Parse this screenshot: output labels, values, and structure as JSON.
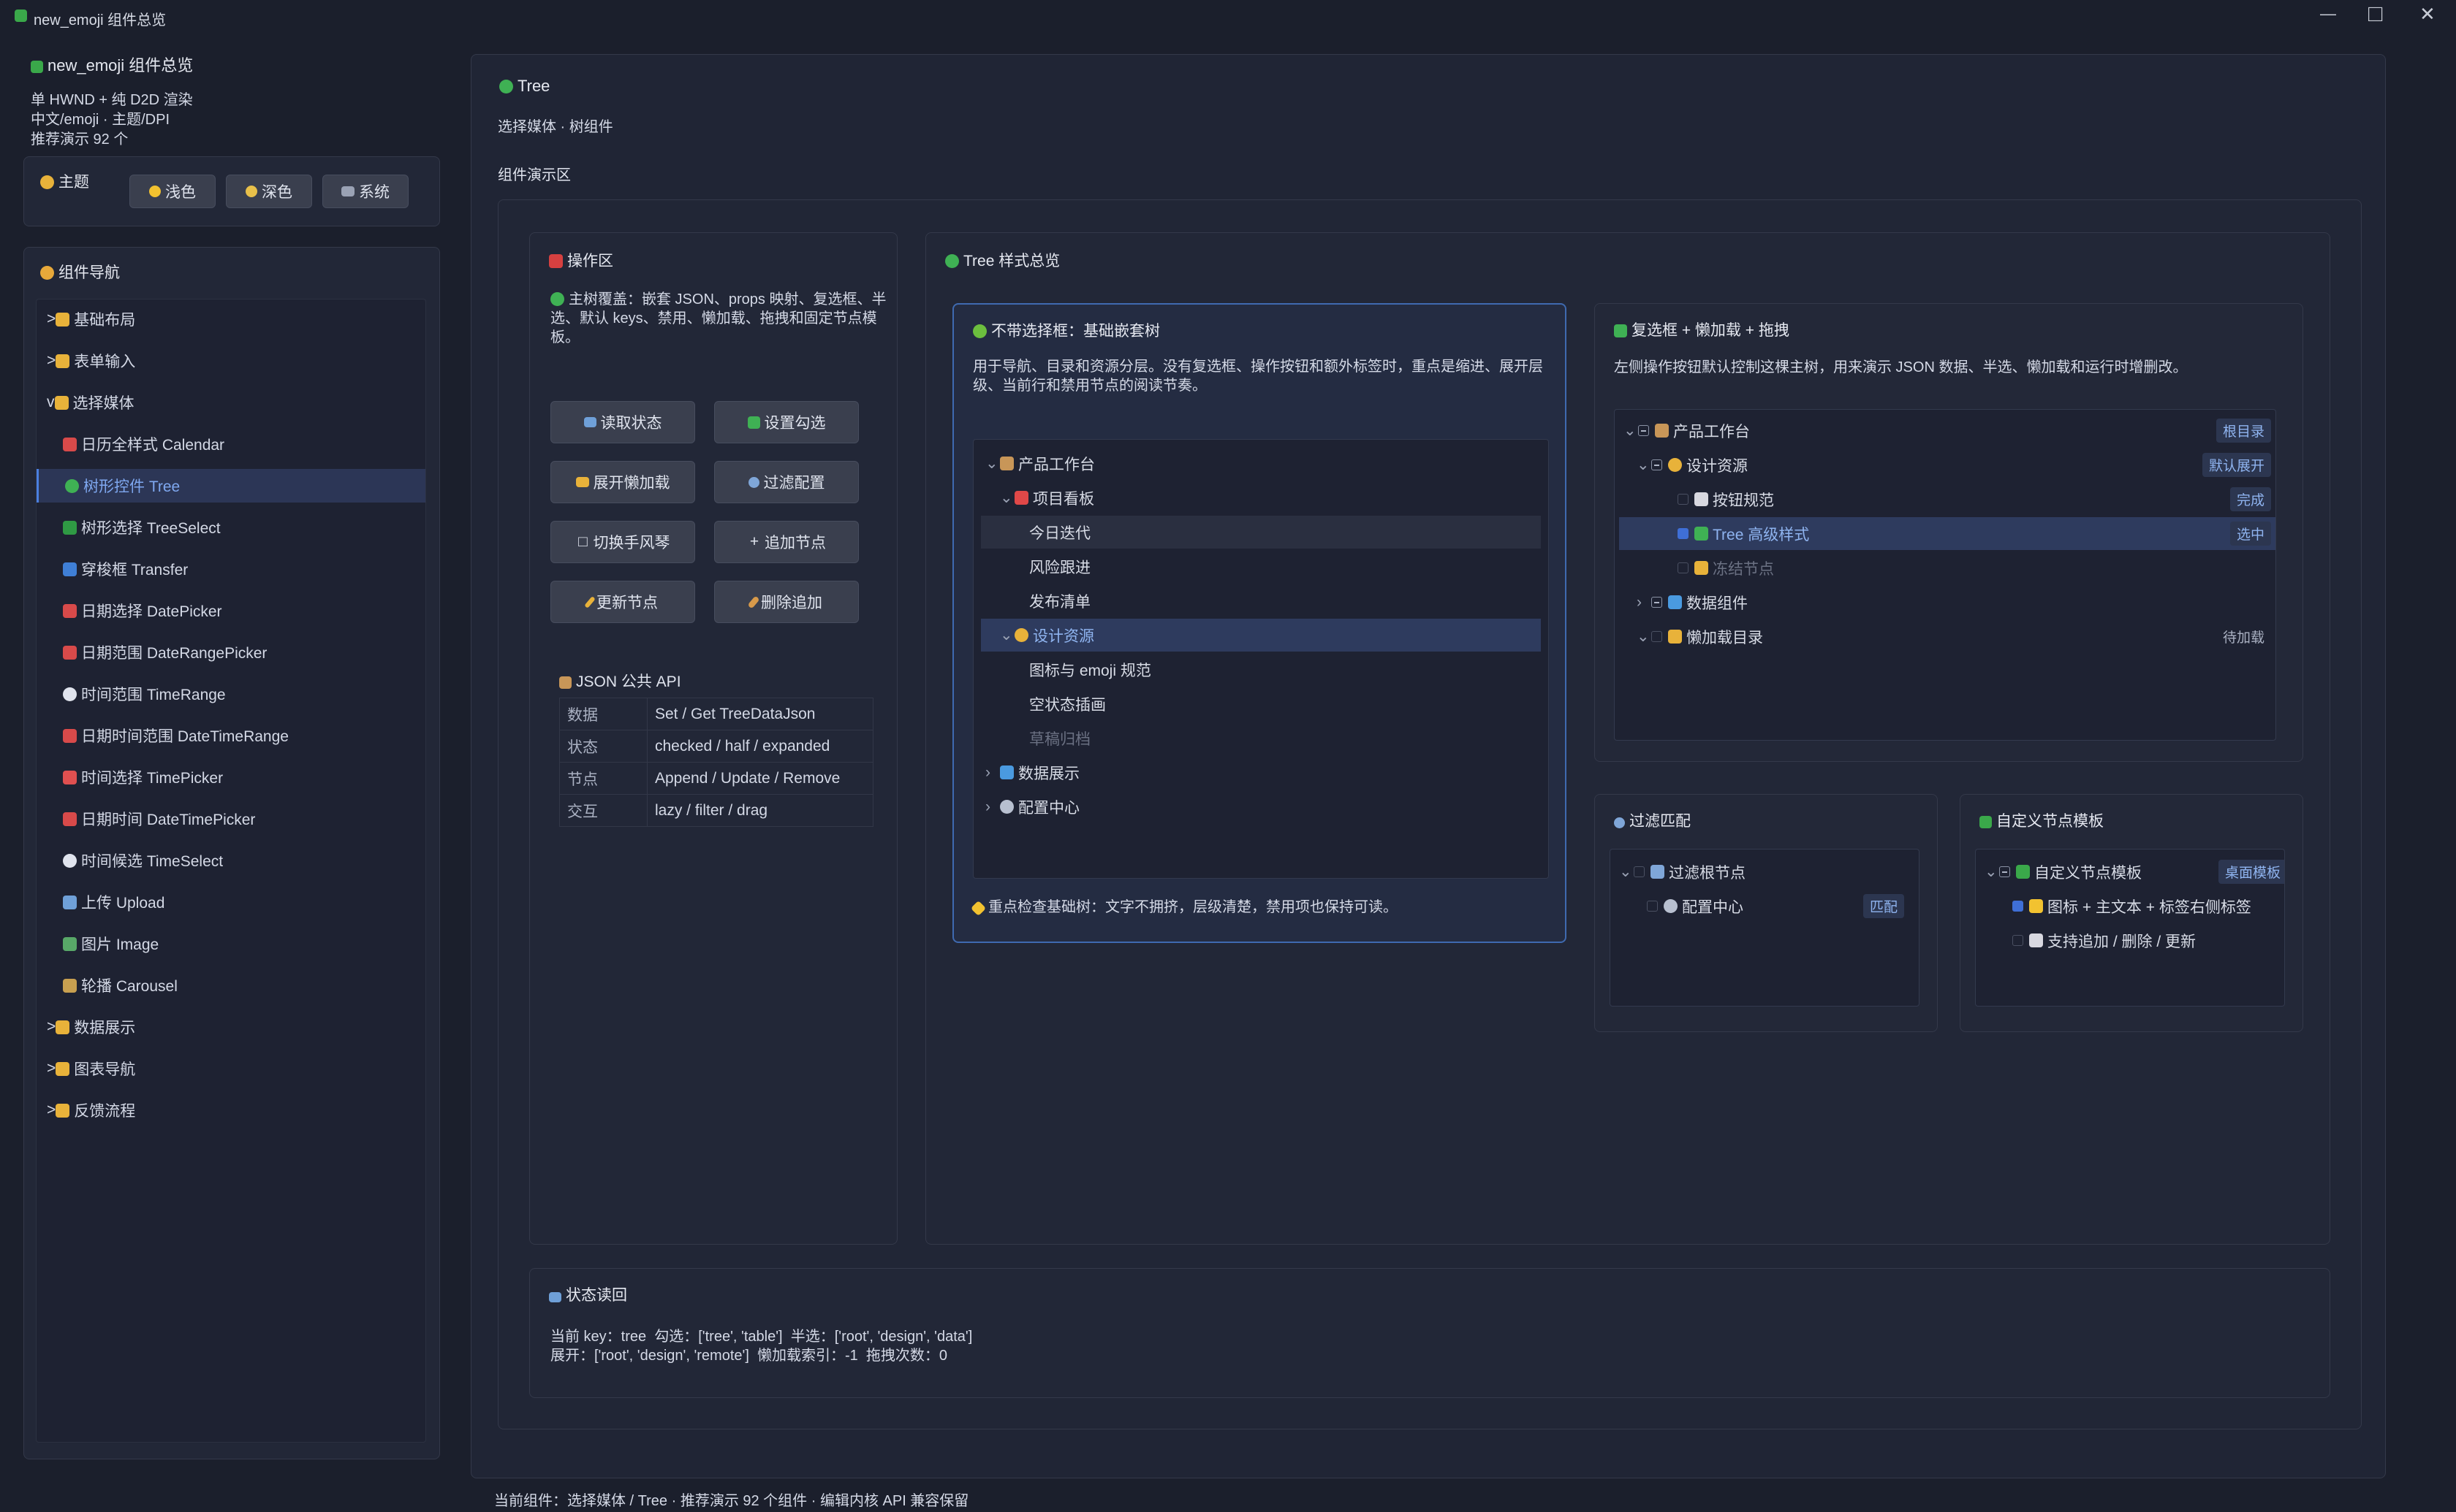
{
  "window": {
    "title": "new_emoji 组件总览",
    "controls": {
      "minimize": "—",
      "maximize": "□",
      "close": "✕"
    }
  },
  "sidebar": {
    "app_title": "new_emoji 组件总览",
    "subtitle_lines": [
      "单 HWND + 纯 D2D 渲染",
      "中文/emoji · 主题/DPI",
      "推荐演示 92 个"
    ],
    "theme": {
      "title": "主题",
      "buttons": [
        "浅色",
        "深色",
        "系统"
      ]
    },
    "nav": {
      "title": "组件导航",
      "items": [
        {
          "label": "基础布局",
          "prefix": ">",
          "icon": "folder-icon"
        },
        {
          "label": "表单输入",
          "prefix": ">",
          "icon": "folder-icon"
        },
        {
          "label": "选择媒体",
          "prefix": "v",
          "icon": "folder-icon"
        },
        {
          "label": "日历全样式 Calendar",
          "icon": "calendar-icon"
        },
        {
          "label": "树形控件 Tree",
          "icon": "tree-icon",
          "selected": true
        },
        {
          "label": "树形选择 TreeSelect",
          "icon": "pine-tree-icon"
        },
        {
          "label": "穿梭框 Transfer",
          "icon": "transfer-icon"
        },
        {
          "label": "日期选择 DatePicker",
          "icon": "calendar-icon"
        },
        {
          "label": "日期范围 DateRangePicker",
          "icon": "calendar-icon"
        },
        {
          "label": "时间范围 TimeRange",
          "icon": "clock-icon"
        },
        {
          "label": "日期时间范围 DateTimeRange",
          "icon": "calendar-icon"
        },
        {
          "label": "时间选择 TimePicker",
          "icon": "alarm-clock-icon"
        },
        {
          "label": "日期时间 DateTimePicker",
          "icon": "calendar-icon"
        },
        {
          "label": "时间候选 TimeSelect",
          "icon": "clock-icon"
        },
        {
          "label": "上传 Upload",
          "icon": "inbox-icon"
        },
        {
          "label": "图片 Image",
          "icon": "picture-icon"
        },
        {
          "label": "轮播 Carousel",
          "icon": "carousel-icon"
        },
        {
          "label": "数据展示",
          "prefix": ">",
          "icon": "folder-icon"
        },
        {
          "label": "图表导航",
          "prefix": ">",
          "icon": "folder-icon"
        },
        {
          "label": "反馈流程",
          "prefix": ">",
          "icon": "folder-icon"
        }
      ]
    }
  },
  "main": {
    "title": "Tree",
    "subtitle": "选择媒体 · 树组件",
    "demo_label": "组件演示区",
    "ops": {
      "title": "操作区",
      "desc": "主树覆盖：嵌套 JSON、props 映射、复选框、半选、默认 keys、禁用、懒加载、拖拽和固定节点模板。",
      "buttons": [
        "读取状态",
        "设置勾选",
        "展开懒加载",
        "过滤配置",
        "切换手风琴",
        "追加节点",
        "更新节点",
        "删除追加"
      ],
      "api_title": "JSON 公共 API",
      "api_rows": [
        [
          "数据",
          "Set / Get TreeDataJson"
        ],
        [
          "状态",
          "checked / half / expanded"
        ],
        [
          "节点",
          "Append / Update / Remove"
        ],
        [
          "交互",
          "lazy / filter / drag"
        ]
      ]
    },
    "overview": {
      "title": "Tree 样式总览",
      "basic": {
        "title": "不带选择框：基础嵌套树",
        "desc": "用于导航、目录和资源分层。没有复选框、操作按钮和额外标签时，重点是缩进、展开层级、当前行和禁用节点的阅读节奏。",
        "nodes": [
          {
            "label": "产品工作台",
            "arrow": "v",
            "icon": "box-icon",
            "level": 0
          },
          {
            "label": "项目看板",
            "arrow": "v",
            "icon": "pin-icon",
            "level": 1
          },
          {
            "label": "今日迭代",
            "level": 2,
            "hover": true
          },
          {
            "label": "风险跟进",
            "level": 2
          },
          {
            "label": "发布清单",
            "level": 2
          },
          {
            "label": "设计资源",
            "arrow": "v",
            "icon": "palette-icon",
            "level": 1,
            "selected": true
          },
          {
            "label": "图标与 emoji 规范",
            "level": 2
          },
          {
            "label": "空状态插画",
            "level": 2
          },
          {
            "label": "草稿归档",
            "level": 2,
            "disabled": true
          },
          {
            "label": "数据展示",
            "arrow": ">",
            "icon": "chart-icon",
            "level": 0
          },
          {
            "label": "配置中心",
            "arrow": ">",
            "icon": "gear-icon",
            "level": 0
          }
        ],
        "footer": "重点检查基础树：文字不拥挤，层级清楚，禁用项也保持可读。"
      },
      "checkbox": {
        "title": "复选框 + 懒加载 + 拖拽",
        "desc": "左侧操作按钮默认控制这棵主树，用来演示 JSON 数据、半选、懒加载和运行时增删改。",
        "nodes": [
          {
            "label": "产品工作台",
            "arrow": "v",
            "check": "half",
            "level": 0,
            "tag": "根目录"
          },
          {
            "label": "设计资源",
            "arrow": "v",
            "check": "half",
            "level": 1,
            "tag": "默认展开"
          },
          {
            "label": "按钮规范",
            "check": "off",
            "level": 2,
            "tag": "完成"
          },
          {
            "label": "Tree 高级样式",
            "check": "on",
            "level": 2,
            "tag": "选中",
            "selected": true
          },
          {
            "label": "冻结节点",
            "check": "off",
            "level": 2,
            "disabled": true
          },
          {
            "label": "数据组件",
            "arrow": ">",
            "check": "half",
            "level": 1
          },
          {
            "label": "懒加载目录",
            "arrow": "v",
            "check": "off",
            "level": 1,
            "tag": "待加载"
          }
        ]
      },
      "filter": {
        "title": "过滤匹配",
        "nodes": [
          {
            "label": "过滤根节点",
            "arrow": "v",
            "level": 0
          },
          {
            "label": "配置中心",
            "level": 1,
            "tag": "匹配"
          }
        ]
      },
      "custom": {
        "title": "自定义节点模板",
        "nodes": [
          {
            "label": "自定义节点模板",
            "arrow": "v",
            "check": "half",
            "level": 0,
            "tag": "桌面模板"
          },
          {
            "label": "图标 + 主文本 + 标签右侧标签",
            "check": "on",
            "level": 1
          },
          {
            "label": "支持追加 / 删除 / 更新",
            "check": "off",
            "level": 1
          }
        ]
      }
    },
    "status": {
      "title": "状态读回",
      "line1": "当前 key：tree  勾选：['tree', 'table']  半选：['root', 'design', 'data']",
      "line2": "展开：['root', 'design', 'remote']  懒加载索引：-1  拖拽次数：0"
    },
    "statusbar": "当前组件：选择媒体 / Tree · 推荐演示 92 个组件 · 编辑内核 API 兼容保留"
  }
}
